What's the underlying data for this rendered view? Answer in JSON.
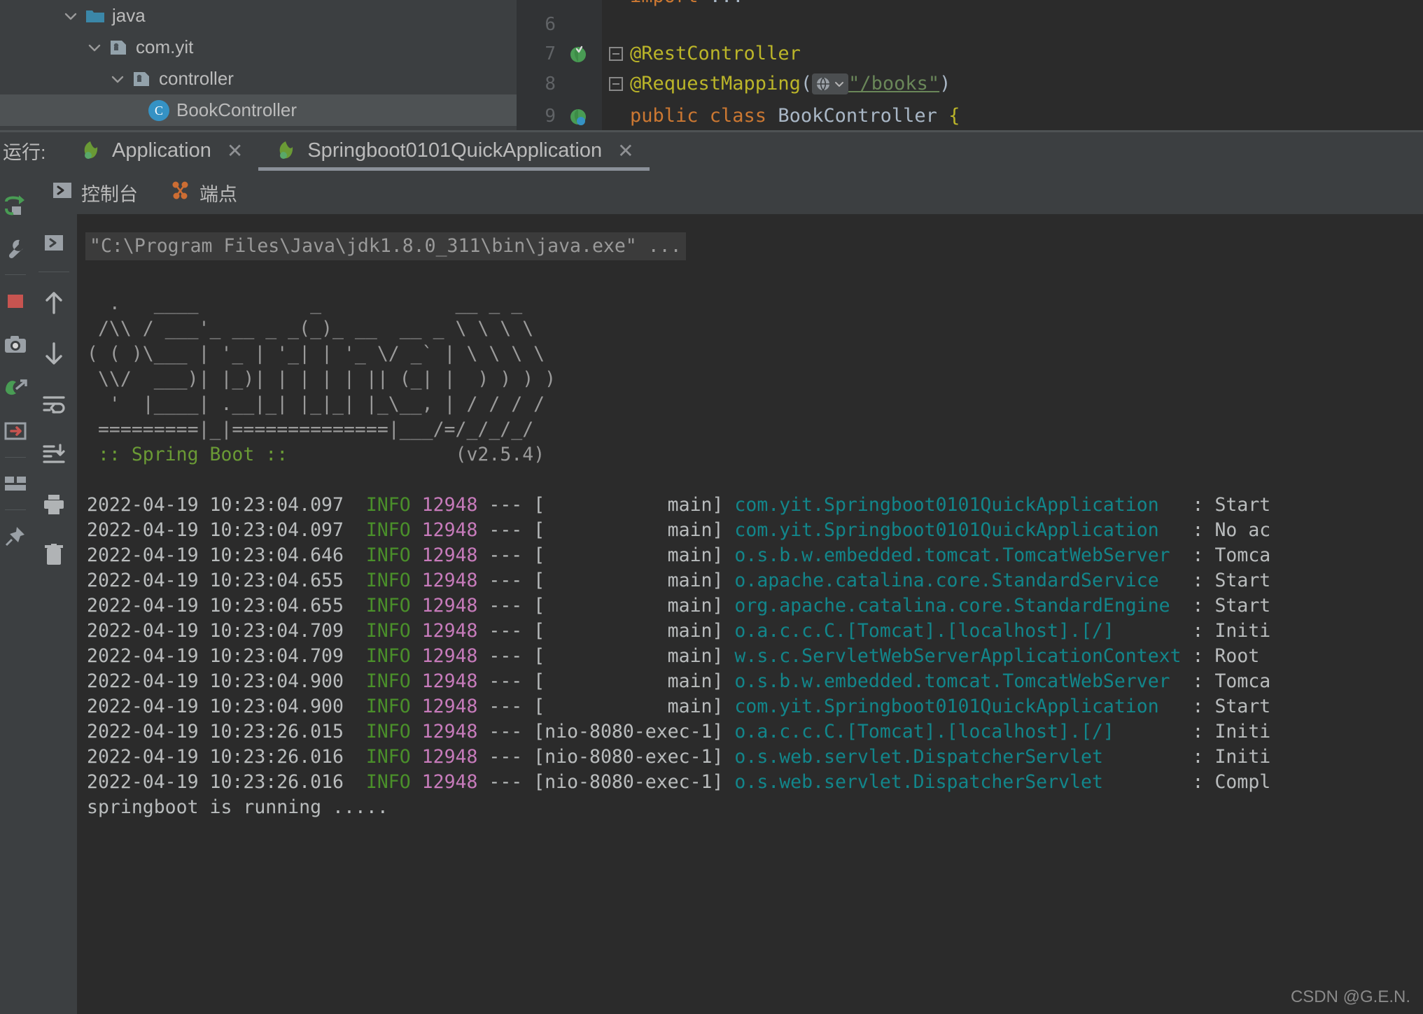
{
  "project_tree": {
    "items": [
      {
        "label": "java",
        "icon": "folder-source-icon",
        "indent": 88,
        "expanded": true
      },
      {
        "label": "com.yit",
        "icon": "package-icon",
        "indent": 122,
        "expanded": true
      },
      {
        "label": "controller",
        "icon": "package-icon",
        "indent": 155,
        "expanded": true
      },
      {
        "label": "BookController",
        "icon": "java-class-icon",
        "indent": 212,
        "expanded": null
      }
    ]
  },
  "editor": {
    "lines": [
      {
        "num": "6",
        "text": "",
        "kind": "blank"
      },
      {
        "num": "7",
        "text": "@RestController",
        "kind": "annotation",
        "has_run_marker": true,
        "has_fold": true
      },
      {
        "num": "8",
        "text": "@RequestMapping(\"/books\")",
        "kind": "mapping",
        "mapping_path": "/books",
        "has_fold": true
      },
      {
        "num": "9",
        "text": "public class BookController {",
        "kind": "class-decl",
        "has_run_marker": true
      }
    ],
    "tokens": {
      "annotation": "@RestController",
      "request_mapping_name": "@RequestMapping",
      "request_mapping_value": "\"/books\"",
      "class_keywords": "public class",
      "class_name": "BookController",
      "open_brace": "{"
    }
  },
  "run_window": {
    "label": "运行:",
    "tabs": [
      {
        "label": "Application",
        "icon": "spring-leaf-icon",
        "active": false,
        "closable": true
      },
      {
        "label": "Springboot0101QuickApplication",
        "icon": "spring-leaf-icon",
        "active": true,
        "closable": true
      }
    ],
    "console_tabs": [
      {
        "label": "控制台",
        "icon": "console-icon",
        "active": true
      },
      {
        "label": "端点",
        "icon": "endpoints-icon",
        "active": false
      }
    ],
    "left_rail": [
      {
        "name": "rerun-icon",
        "title": "rerun"
      },
      {
        "name": "wrench-settings-icon",
        "title": "settings"
      },
      {
        "name": "stop-icon",
        "title": "stop"
      },
      {
        "name": "camera-snapshot-icon",
        "title": "snapshot"
      },
      {
        "name": "thread-dump-icon",
        "title": "thread-dump"
      },
      {
        "name": "exit-icon",
        "title": "exit"
      },
      {
        "name": "layout-icon",
        "title": "layout"
      },
      {
        "name": "pin-icon",
        "title": "pin"
      }
    ],
    "console_rail": [
      {
        "name": "expand-icon",
        "title": "expand"
      },
      {
        "name": "arrow-up-icon",
        "title": "up"
      },
      {
        "name": "arrow-down-icon",
        "title": "down"
      },
      {
        "name": "soft-wrap-icon",
        "title": "soft-wrap"
      },
      {
        "name": "scroll-to-end-icon",
        "title": "scroll-to-end"
      },
      {
        "name": "print-icon",
        "title": "print"
      },
      {
        "name": "trash-icon",
        "title": "clear-all"
      }
    ]
  },
  "console": {
    "command_line": "\"C:\\Program Files\\Java\\jdk1.8.0_311\\bin\\java.exe\" ...",
    "banner": [
      "  .   ____          _            __ _ _",
      " /\\\\ / ___'_ __ _ _(_)_ __  __ _ \\ \\ \\ \\",
      "( ( )\\___ | '_ | '_| | '_ \\/ _` | \\ \\ \\ \\",
      " \\\\/  ___)| |_)| | | | | || (_| |  ) ) ) )",
      "  '  |____| .__|_| |_|_| |_\\__, | / / / /",
      " =========|_|==============|___/=/_/_/_/"
    ],
    "banner_version_label": " :: Spring Boot :: ",
    "banner_version": "(v2.5.4)",
    "log_lines": [
      {
        "time": "2022-04-19 10:23:04.097",
        "level": "INFO",
        "pid": "12948",
        "sep": "---",
        "thread": "[           main]",
        "logger": "com.yit.Springboot0101QuickApplication",
        "msg": ": Start"
      },
      {
        "time": "2022-04-19 10:23:04.097",
        "level": "INFO",
        "pid": "12948",
        "sep": "---",
        "thread": "[           main]",
        "logger": "com.yit.Springboot0101QuickApplication",
        "msg": ": No ac"
      },
      {
        "time": "2022-04-19 10:23:04.646",
        "level": "INFO",
        "pid": "12948",
        "sep": "---",
        "thread": "[           main]",
        "logger": "o.s.b.w.embedded.tomcat.TomcatWebServer",
        "msg": ": Tomca"
      },
      {
        "time": "2022-04-19 10:23:04.655",
        "level": "INFO",
        "pid": "12948",
        "sep": "---",
        "thread": "[           main]",
        "logger": "o.apache.catalina.core.StandardService",
        "msg": ": Start"
      },
      {
        "time": "2022-04-19 10:23:04.655",
        "level": "INFO",
        "pid": "12948",
        "sep": "---",
        "thread": "[           main]",
        "logger": "org.apache.catalina.core.StandardEngine",
        "msg": ": Start"
      },
      {
        "time": "2022-04-19 10:23:04.709",
        "level": "INFO",
        "pid": "12948",
        "sep": "---",
        "thread": "[           main]",
        "logger": "o.a.c.c.C.[Tomcat].[localhost].[/]",
        "msg": ": Initi"
      },
      {
        "time": "2022-04-19 10:23:04.709",
        "level": "INFO",
        "pid": "12948",
        "sep": "---",
        "thread": "[           main]",
        "logger": "w.s.c.ServletWebServerApplicationContext",
        "msg": ": Root "
      },
      {
        "time": "2022-04-19 10:23:04.900",
        "level": "INFO",
        "pid": "12948",
        "sep": "---",
        "thread": "[           main]",
        "logger": "o.s.b.w.embedded.tomcat.TomcatWebServer",
        "msg": ": Tomca"
      },
      {
        "time": "2022-04-19 10:23:04.900",
        "level": "INFO",
        "pid": "12948",
        "sep": "---",
        "thread": "[           main]",
        "logger": "com.yit.Springboot0101QuickApplication",
        "msg": ": Start"
      },
      {
        "time": "2022-04-19 10:23:26.015",
        "level": "INFO",
        "pid": "12948",
        "sep": "---",
        "thread": "[nio-8080-exec-1]",
        "logger": "o.a.c.c.C.[Tomcat].[localhost].[/]",
        "msg": ": Initi"
      },
      {
        "time": "2022-04-19 10:23:26.016",
        "level": "INFO",
        "pid": "12948",
        "sep": "---",
        "thread": "[nio-8080-exec-1]",
        "logger": "o.s.web.servlet.DispatcherServlet",
        "msg": ": Initi"
      },
      {
        "time": "2022-04-19 10:23:26.016",
        "level": "INFO",
        "pid": "12948",
        "sep": "---",
        "thread": "[nio-8080-exec-1]",
        "logger": "o.s.web.servlet.DispatcherServlet",
        "msg": ": Compl"
      }
    ],
    "tail_line": "springboot is running ....."
  },
  "watermark": "CSDN @G.E.N.",
  "colors": {
    "panel_bg": "#3c3f41",
    "editor_bg": "#2b2b2b",
    "gutter_bg": "#313335",
    "text": "#bbbbbb",
    "annotation": "#bbb529",
    "keyword": "#cc7832",
    "string": "#6a8759",
    "logger": "#12868b",
    "info": "#4a8f2a",
    "pid": "#c77bbb",
    "spring_green": "#6a9a35",
    "accent_blue": "#3592c4"
  }
}
